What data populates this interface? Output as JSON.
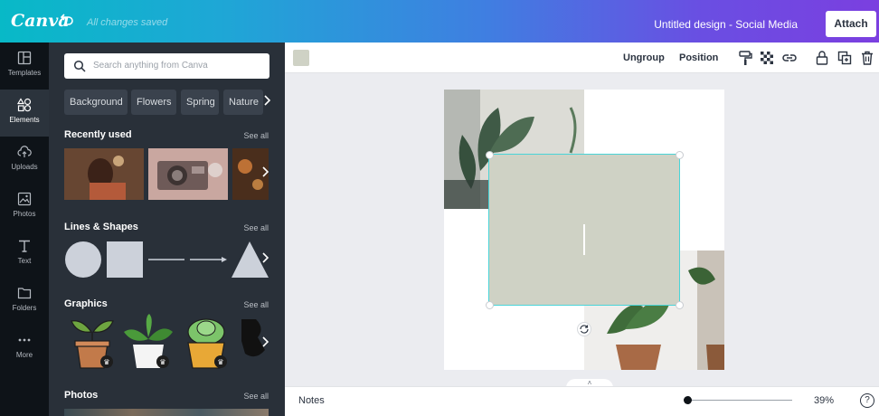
{
  "header": {
    "logo": "Canva",
    "saved_status": "All changes saved",
    "design_title": "Untitled design - Social Media",
    "attach_label": "Attach",
    "gradient": [
      "#08b9c7",
      "#7b3fe0"
    ]
  },
  "rail": {
    "items": [
      {
        "label": "Templates",
        "icon": "templates-icon"
      },
      {
        "label": "Elements",
        "icon": "elements-icon",
        "active": true
      },
      {
        "label": "Uploads",
        "icon": "upload-cloud-icon"
      },
      {
        "label": "Photos",
        "icon": "photo-icon"
      },
      {
        "label": "Text",
        "icon": "text-icon"
      },
      {
        "label": "Folders",
        "icon": "folder-icon"
      },
      {
        "label": "More",
        "icon": "more-dots-icon"
      }
    ]
  },
  "panel": {
    "search_placeholder": "Search anything from Canva",
    "chips": [
      "Background",
      "Flowers",
      "Spring",
      "Nature"
    ],
    "sections": {
      "recent": {
        "title": "Recently used",
        "see_all": "See all"
      },
      "lines": {
        "title": "Lines & Shapes",
        "see_all": "See all"
      },
      "graphics": {
        "title": "Graphics",
        "see_all": "See all"
      },
      "photos": {
        "title": "Photos",
        "see_all": "See all"
      }
    }
  },
  "toolbar": {
    "swatch_color": "#cfd2c5",
    "ungroup_label": "Ungroup",
    "position_label": "Position"
  },
  "canvas": {
    "selection_color": "#cfd2c5",
    "selection_outline": "#49d4d8"
  },
  "bottombar": {
    "notes_label": "Notes",
    "zoom_value": "39%",
    "zoom_fraction": 0.0,
    "help_label": "?"
  }
}
